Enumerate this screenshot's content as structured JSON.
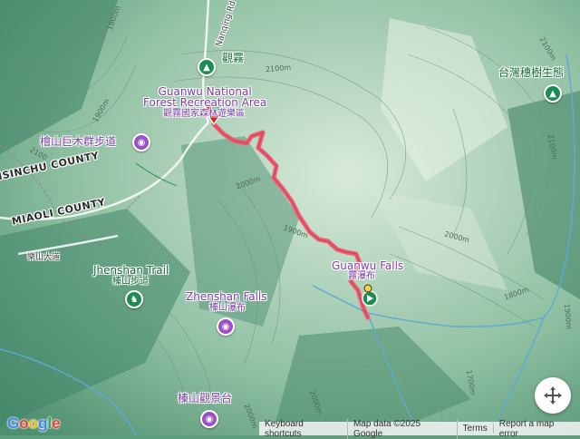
{
  "map": {
    "pois": {
      "guanwu": "觀霧",
      "nfra_en": "Guanwu National\nForest Recreation Area",
      "nfra_zh": "觀霧國家森林遊樂區",
      "cypress_trail": "檜山巨木群步道",
      "taiwan_cypress": "台灣穗樹生態",
      "falls_en": "Guanwu Falls",
      "falls_zh": "霧瀑布",
      "jhenshan_trail_en": "Jhenshan Trail",
      "jhenshan_trail_zh": "榛山步道",
      "zhenshan_falls_en": "Zhenshan Falls",
      "zhenshan_falls_zh": "榛山瀑布",
      "zhenshan_view": "榛山觀景台"
    },
    "counties": {
      "hsinchu": "HSINCHU COUNTY",
      "miaoli": "MIAOLI COUNTY"
    },
    "roads": {
      "nanqing": "Nanqing Rd",
      "leshan": "樂山大道"
    },
    "contours": [
      "1800m",
      "1900m",
      "2100m",
      "2100",
      "2000m",
      "2100m",
      "1900m",
      "2000m",
      "1800m",
      "1900m",
      "2000m",
      "2000m",
      "2100m",
      "1700m"
    ],
    "colors": {
      "route": "#f0576e",
      "poi": "#9c4fc7",
      "start": "#1d8c52",
      "end": "#c62828"
    }
  },
  "controls": {
    "logo": "Google",
    "footer": [
      "Keyboard shortcuts",
      "Map data ©2025 Google",
      "Terms",
      "Report a map error"
    ]
  }
}
